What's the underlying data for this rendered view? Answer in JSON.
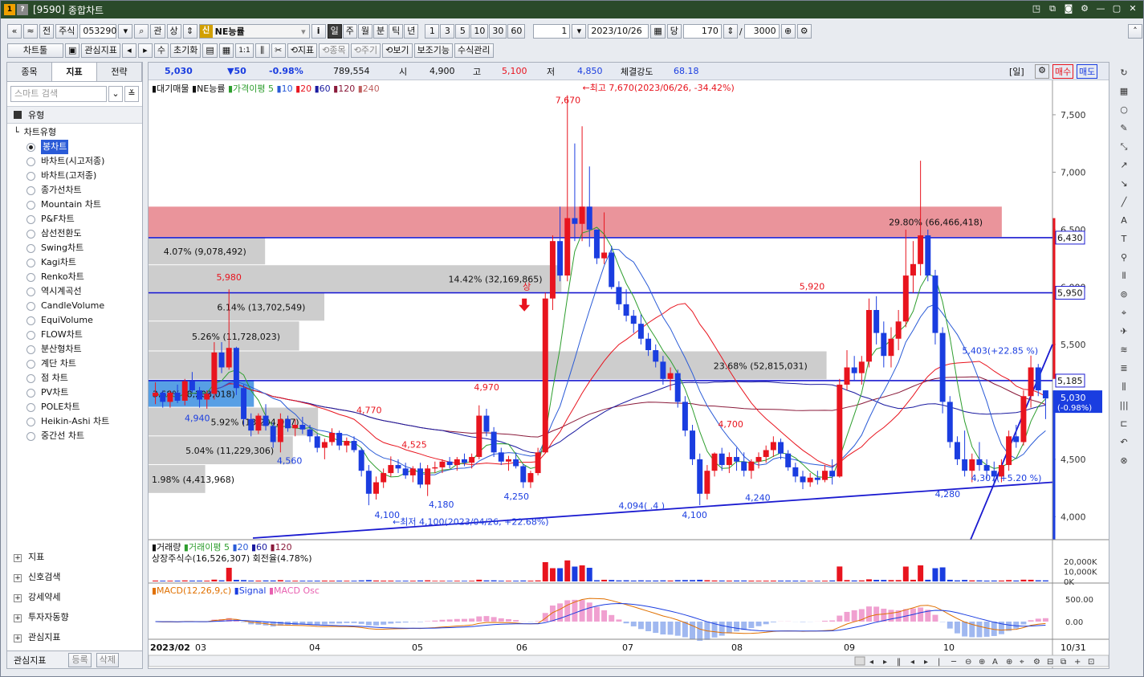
{
  "title": {
    "code_badge": "[9590]",
    "name": "종합차트"
  },
  "toolbar1": {
    "nav_prev": "«",
    "nav_up": "≈",
    "prev_label": "전",
    "market": "주식",
    "code": "053290",
    "gwan": "관",
    "sang": "상",
    "sin_badge": "신",
    "stock_name": "NE능률",
    "info": "i",
    "periods": [
      "일",
      "주",
      "월",
      "분",
      "틱",
      "년"
    ],
    "selected_period": "일",
    "minutes": [
      "1",
      "3",
      "5",
      "10",
      "30",
      "60"
    ],
    "unit_count": "1",
    "date": "2023/10/26",
    "dang": "당",
    "count": "170",
    "slash": "/",
    "total": "3000"
  },
  "toolbar2": {
    "chart_tools": "차트툴",
    "watch_indicators": "관심지표",
    "su": "수",
    "reset": "초기화",
    "one_one": "1:1",
    "indicator": "지표",
    "jongmok": "종목",
    "jugi": "주기",
    "bogi": "보기",
    "aux": "보조기능",
    "formula": "수식관리"
  },
  "left": {
    "tabs": [
      "종목",
      "지표",
      "전략"
    ],
    "selected_tab": "지표",
    "search_placeholder": "스마트 검색",
    "group_header": "유형",
    "tree_node": "차트유형",
    "chart_types": [
      "봉차트",
      "바차트(시고저종)",
      "바차트(고저종)",
      "종가선차트",
      "Mountain 차트",
      "P&F차트",
      "삼선전환도",
      "Swing차트",
      "Kagi차트",
      "Renko차트",
      "역시계곡선",
      "CandleVolume",
      "EquiVolume",
      "FLOW차트",
      "분산형차트",
      "계단 차트",
      "점 차트",
      "PV차트",
      "POLE차트",
      "Heikin-Ashi 차트",
      "중간선 차트"
    ],
    "selected_type": "봉차트",
    "bottom_groups": [
      "지표",
      "신호검색",
      "강세약세",
      "투자자동향",
      "관심지표"
    ],
    "interest_label": "관심지표",
    "register": "등록",
    "delete": "삭제"
  },
  "pricebar": {
    "price": "5,030",
    "change": "▼50",
    "pct": "-0.98%",
    "volume": "789,554",
    "open_label": "시",
    "open": "4,900",
    "high_label": "고",
    "high": "5,100",
    "low_label": "저",
    "low": "4,850",
    "strength_label": "체결강도",
    "strength": "68.18",
    "period_badge": "[일]",
    "buy": "매수",
    "sell": "매도"
  },
  "legend": {
    "supply": "대기매물",
    "name": "NE능률",
    "ma_label": "가격이평 5",
    "ma": [
      "10",
      "20",
      "60",
      "120",
      "240"
    ],
    "vol_label": "거래량",
    "vol_ma_label": "거래이평 5",
    "vol_ma": [
      "20",
      "60",
      "120"
    ],
    "shares_info": "상장주식수(16,526,307) 회전율(4.78%)",
    "macd": "MACD(12,26,9,c)",
    "signal": "Signal",
    "osc": "MACD Osc"
  },
  "colors": {
    "up": "#e8141e",
    "down": "#1a3de0",
    "ma5": "#2e9e2e",
    "ma10": "#2a5bd7",
    "ma20": "#e8141e",
    "ma60": "#1a1aa0",
    "ma120": "#8a1a3a",
    "ma240": "#c06060",
    "supply_box": "#c8c8c8",
    "supply_hi": "#e88890"
  },
  "chart_data": {
    "type": "candlestick",
    "x_axis_labels": [
      "2023/02",
      "03",
      "04",
      "05",
      "06",
      "07",
      "08",
      "09",
      "10",
      "10/31"
    ],
    "y_ticks": [
      "7,500",
      "7,000",
      "6,500",
      "6,000",
      "5,500",
      "5,000",
      "4,500",
      "4,000"
    ],
    "y_range": [
      3800,
      7800
    ],
    "price_markers": [
      "6,430",
      "5,950",
      "5,185"
    ],
    "current_marker": "5,030",
    "current_pct": "(-0.98%)",
    "supply_levels": [
      {
        "text": "29.80% (66,466,418)",
        "lo": 6430,
        "hi": 6700,
        "hot": true
      },
      {
        "text": "4.07% (9,078,492)",
        "lo": 6190,
        "hi": 6430
      },
      {
        "text": "14.42% (32,169,865)",
        "lo": 5950,
        "hi": 6190
      },
      {
        "text": "6.14% (13,702,549)",
        "lo": 5700,
        "hi": 5950
      },
      {
        "text": "5.26% (11,728,023)",
        "lo": 5440,
        "hi": 5700
      },
      {
        "text": "23.68% (52,815,031)",
        "lo": 5190,
        "hi": 5440
      },
      {
        "text": "3.68% (8,203,018)",
        "lo": 4950,
        "hi": 5190,
        "cur": true
      },
      {
        "text": "5.92% (13,204,957)",
        "lo": 4700,
        "hi": 4950
      },
      {
        "text": "5.04% (11,229,306)",
        "lo": 4450,
        "hi": 4700
      },
      {
        "text": "1.98% (4,413,968)",
        "lo": 4200,
        "hi": 4450
      }
    ],
    "annotations": [
      {
        "text": "←최고 7,670(2023/06/26, -34.42%)",
        "x": 0.48,
        "y": 7710,
        "c": "up"
      },
      {
        "text": "7,670",
        "x": 0.45,
        "y": 7600,
        "c": "up"
      },
      {
        "text": "5,980",
        "x": 0.075,
        "y": 6060,
        "c": "up"
      },
      {
        "text": "4,970",
        "x": 0.36,
        "y": 5100,
        "c": "up"
      },
      {
        "text": "4,770",
        "x": 0.23,
        "y": 4900,
        "c": "up"
      },
      {
        "text": "4,525",
        "x": 0.28,
        "y": 4600,
        "c": "up"
      },
      {
        "text": "5,920",
        "x": 0.72,
        "y": 5980,
        "c": "up"
      },
      {
        "text": "4,700",
        "x": 0.63,
        "y": 4780,
        "c": "up"
      },
      {
        "text": "4,940",
        "x": 0.04,
        "y": 4830,
        "c": "down"
      },
      {
        "text": "4,560",
        "x": 0.142,
        "y": 4460,
        "c": "down"
      },
      {
        "text": "4,100",
        "x": 0.25,
        "y": 3990,
        "c": "down"
      },
      {
        "text": "4,180",
        "x": 0.31,
        "y": 4080,
        "c": "down"
      },
      {
        "text": "4,250",
        "x": 0.393,
        "y": 4150,
        "c": "down"
      },
      {
        "text": "4,094(  .4 )",
        "x": 0.52,
        "y": 4070,
        "c": "down"
      },
      {
        "text": "4,100",
        "x": 0.59,
        "y": 3990,
        "c": "down"
      },
      {
        "text": "4,240",
        "x": 0.66,
        "y": 4140,
        "c": "down"
      },
      {
        "text": "4,280",
        "x": 0.87,
        "y": 4170,
        "c": "down"
      },
      {
        "text": "4,307(+5.20 %)",
        "x": 0.91,
        "y": 4310,
        "c": "down"
      },
      {
        "text": "5,403(+22.85 %)",
        "x": 0.9,
        "y": 5420,
        "c": "down"
      },
      {
        "text": "←최저 4,100(2023/04/26, +22.68%)",
        "x": 0.27,
        "y": 3930,
        "c": "down"
      },
      {
        "text": "상",
        "x": 0.414,
        "y": 5980,
        "c": "up"
      }
    ],
    "candles": [
      [
        5050,
        5170,
        4980,
        5080
      ],
      [
        5080,
        5100,
        4950,
        5000
      ],
      [
        5000,
        5100,
        4950,
        5080
      ],
      [
        5080,
        5150,
        4990,
        5010
      ],
      [
        5010,
        5200,
        4970,
        5180
      ],
      [
        5180,
        5260,
        5080,
        5100
      ],
      [
        5100,
        5130,
        4950,
        5020
      ],
      [
        5020,
        5100,
        4940,
        5070
      ],
      [
        5070,
        5520,
        5020,
        5430
      ],
      [
        5430,
        5520,
        5250,
        5300
      ],
      [
        5300,
        5980,
        5280,
        5470
      ],
      [
        5470,
        5480,
        5060,
        5120
      ],
      [
        5120,
        5150,
        4800,
        4850
      ],
      [
        4850,
        4900,
        4700,
        4750
      ],
      [
        4750,
        4900,
        4720,
        4880
      ],
      [
        4880,
        4980,
        4750,
        4790
      ],
      [
        4790,
        4820,
        4600,
        4650
      ],
      [
        4650,
        4900,
        4560,
        4850
      ],
      [
        4850,
        4880,
        4740,
        4770
      ],
      [
        4770,
        4850,
        4700,
        4800
      ],
      [
        4800,
        4870,
        4720,
        4760
      ],
      [
        4760,
        4800,
        4650,
        4700
      ],
      [
        4700,
        4720,
        4560,
        4600
      ],
      [
        4600,
        4680,
        4500,
        4650
      ],
      [
        4650,
        4770,
        4620,
        4730
      ],
      [
        4730,
        4750,
        4580,
        4620
      ],
      [
        4620,
        4690,
        4560,
        4660
      ],
      [
        4660,
        4700,
        4560,
        4580
      ],
      [
        4580,
        4600,
        4350,
        4400
      ],
      [
        4400,
        4450,
        4100,
        4200
      ],
      [
        4200,
        4350,
        4150,
        4300
      ],
      [
        4300,
        4420,
        4250,
        4380
      ],
      [
        4380,
        4525,
        4350,
        4450
      ],
      [
        4450,
        4500,
        4380,
        4420
      ],
      [
        4420,
        4470,
        4330,
        4360
      ],
      [
        4360,
        4440,
        4300,
        4420
      ],
      [
        4420,
        4470,
        4250,
        4280
      ],
      [
        4280,
        4450,
        4180,
        4420
      ],
      [
        4420,
        4480,
        4380,
        4430
      ],
      [
        4430,
        4500,
        4380,
        4480
      ],
      [
        4480,
        4520,
        4420,
        4450
      ],
      [
        4450,
        4520,
        4400,
        4500
      ],
      [
        4500,
        4550,
        4440,
        4470
      ],
      [
        4470,
        4550,
        4420,
        4520
      ],
      [
        4520,
        4970,
        4500,
        4880
      ],
      [
        4880,
        4940,
        4700,
        4740
      ],
      [
        4740,
        4780,
        4520,
        4560
      ],
      [
        4560,
        4600,
        4450,
        4480
      ],
      [
        4480,
        4530,
        4400,
        4500
      ],
      [
        4500,
        4560,
        4420,
        4440
      ],
      [
        4440,
        4460,
        4250,
        4300
      ],
      [
        4300,
        4400,
        4250,
        4380
      ],
      [
        4380,
        4600,
        4360,
        4560
      ],
      [
        4560,
        5950,
        4550,
        5900
      ],
      [
        5900,
        6450,
        5800,
        6400
      ],
      [
        6400,
        6700,
        6050,
        6100
      ],
      [
        6100,
        7670,
        6050,
        6600
      ],
      [
        6600,
        7250,
        6400,
        6550
      ],
      [
        6550,
        7400,
        6400,
        6700
      ],
      [
        6700,
        7050,
        6350,
        6500
      ],
      [
        6500,
        6500,
        6200,
        6250
      ],
      [
        6250,
        6650,
        6200,
        6300
      ],
      [
        6300,
        6360,
        5980,
        6000
      ],
      [
        6000,
        6050,
        5800,
        5850
      ],
      [
        5850,
        5980,
        5700,
        5750
      ],
      [
        5750,
        5800,
        5600,
        5680
      ],
      [
        5680,
        5760,
        5500,
        5550
      ],
      [
        5550,
        5600,
        5400,
        5450
      ],
      [
        5450,
        5500,
        5300,
        5350
      ],
      [
        5350,
        5400,
        5150,
        5200
      ],
      [
        5200,
        5300,
        5100,
        5250
      ],
      [
        5250,
        5280,
        4950,
        5000
      ],
      [
        5000,
        5050,
        4700,
        4750
      ],
      [
        4750,
        4800,
        4450,
        4500
      ],
      [
        4500,
        4550,
        4100,
        4200
      ],
      [
        4200,
        4450,
        4150,
        4400
      ],
      [
        4400,
        4560,
        4350,
        4550
      ],
      [
        4550,
        4600,
        4400,
        4450
      ],
      [
        4450,
        4560,
        4380,
        4520
      ],
      [
        4520,
        4600,
        4400,
        4480
      ],
      [
        4480,
        4560,
        4350,
        4400
      ],
      [
        4400,
        4500,
        4330,
        4480
      ],
      [
        4480,
        4560,
        4420,
        4520
      ],
      [
        4520,
        4620,
        4470,
        4580
      ],
      [
        4580,
        4700,
        4520,
        4650
      ],
      [
        4650,
        4680,
        4500,
        4550
      ],
      [
        4550,
        4580,
        4400,
        4430
      ],
      [
        4430,
        4470,
        4300,
        4350
      ],
      [
        4350,
        4400,
        4240,
        4300
      ],
      [
        4300,
        4380,
        4260,
        4340
      ],
      [
        4340,
        4400,
        4280,
        4320
      ],
      [
        4320,
        4450,
        4300,
        4400
      ],
      [
        4400,
        4500,
        4280,
        4350
      ],
      [
        4350,
        5200,
        4340,
        5150
      ],
      [
        5150,
        5450,
        5100,
        5300
      ],
      [
        5300,
        5400,
        5180,
        5250
      ],
      [
        5250,
        5400,
        5150,
        5350
      ],
      [
        5350,
        5900,
        5300,
        5800
      ],
      [
        5800,
        5920,
        5500,
        5600
      ],
      [
        5600,
        5700,
        5300,
        5400
      ],
      [
        5400,
        5650,
        5300,
        5550
      ],
      [
        5550,
        5800,
        5450,
        5700
      ],
      [
        5700,
        6500,
        5650,
        6100
      ],
      [
        6100,
        6400,
        5950,
        6200
      ],
      [
        6200,
        7100,
        6100,
        6450
      ],
      [
        6450,
        6500,
        6050,
        6100
      ],
      [
        6100,
        6150,
        5500,
        5600
      ],
      [
        5600,
        5650,
        4900,
        5000
      ],
      [
        5000,
        5050,
        4600,
        4650
      ],
      [
        4650,
        4700,
        4450,
        4500
      ],
      [
        4500,
        4750,
        4350,
        4400
      ],
      [
        4400,
        4550,
        4300,
        4500
      ],
      [
        4500,
        4650,
        4400,
        4450
      ],
      [
        4450,
        4500,
        4330,
        4400
      ],
      [
        4400,
        4480,
        4280,
        4350
      ],
      [
        4350,
        4500,
        4300,
        4450
      ],
      [
        4450,
        4750,
        4400,
        4700
      ],
      [
        4700,
        4800,
        4600,
        4650
      ],
      [
        4650,
        5100,
        4620,
        5050
      ],
      [
        5050,
        5403,
        4950,
        5300
      ],
      [
        5300,
        5330,
        5050,
        5100
      ],
      [
        5100,
        5100,
        4850,
        5030
      ]
    ],
    "volume_range_label": [
      "20,000K",
      "10,000K",
      "0K"
    ],
    "macd_ticks": [
      "500.00",
      "0.00"
    ]
  }
}
